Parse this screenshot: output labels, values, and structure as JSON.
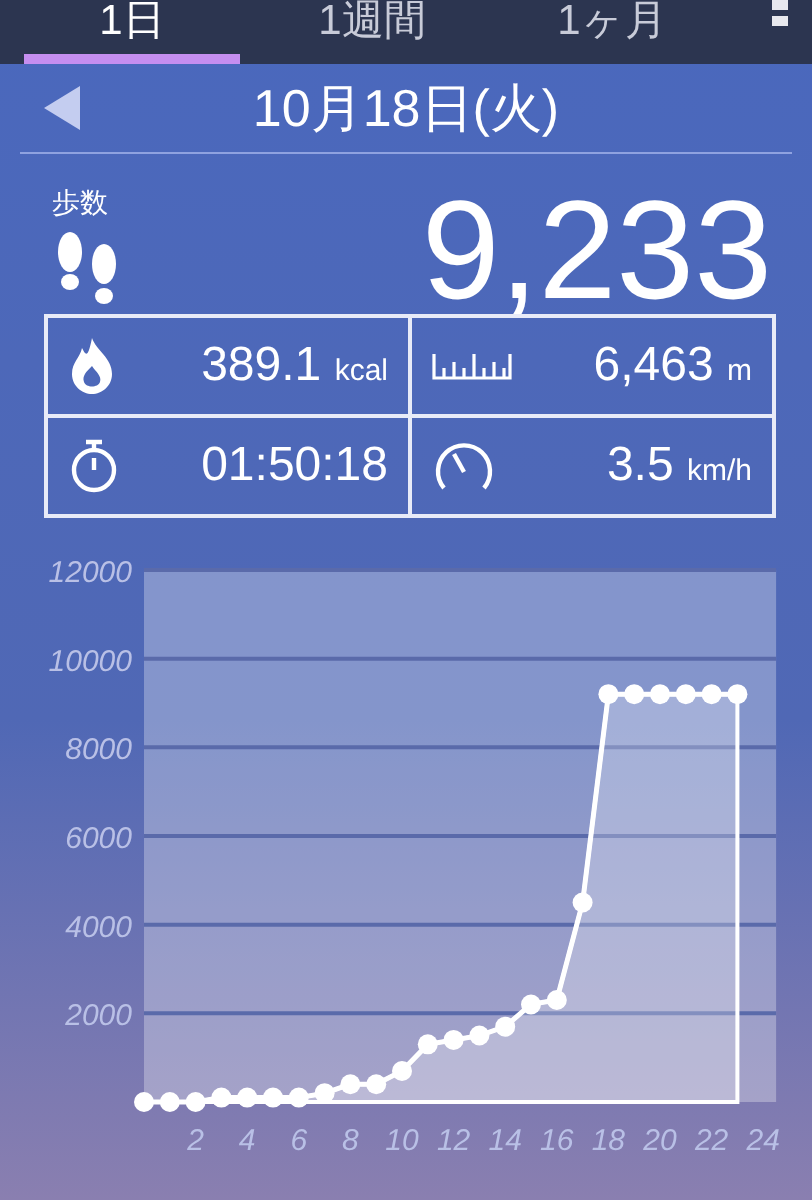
{
  "tabs": [
    {
      "label": "1日",
      "selected": true
    },
    {
      "label": "1週間",
      "selected": false
    },
    {
      "label": "1ヶ月",
      "selected": false
    }
  ],
  "date": "10月18日(火)",
  "steps": {
    "label": "歩数",
    "value": "9,233"
  },
  "stats": [
    {
      "kind": "calories",
      "value": "389.1",
      "unit": "kcal"
    },
    {
      "kind": "distance",
      "value": "6,463",
      "unit": "m"
    },
    {
      "kind": "time",
      "value": "01:50:18"
    },
    {
      "kind": "speed",
      "value": "3.5",
      "unit": "km/h"
    }
  ],
  "chart_data": {
    "type": "area",
    "x": [
      0,
      1,
      2,
      3,
      4,
      5,
      6,
      7,
      8,
      9,
      10,
      11,
      12,
      13,
      14,
      15,
      16,
      17,
      18,
      19,
      20,
      21,
      22,
      23
    ],
    "series": [
      {
        "color": "#ffffff",
        "values": [
          0,
          0,
          0,
          100,
          100,
          100,
          100,
          200,
          400,
          400,
          700,
          1300,
          1400,
          1500,
          1700,
          2200,
          2300,
          4500,
          9200,
          9200,
          9200,
          9200,
          9200,
          9200
        ]
      }
    ],
    "grid": true,
    "xlim": [
      0,
      24.5
    ],
    "ylim": [
      0,
      12000
    ],
    "xticks": [
      2,
      4,
      6,
      8,
      10,
      12,
      14,
      16,
      18,
      20,
      22,
      24
    ],
    "yticks": [
      2000,
      4000,
      6000,
      8000,
      10000,
      12000
    ]
  }
}
